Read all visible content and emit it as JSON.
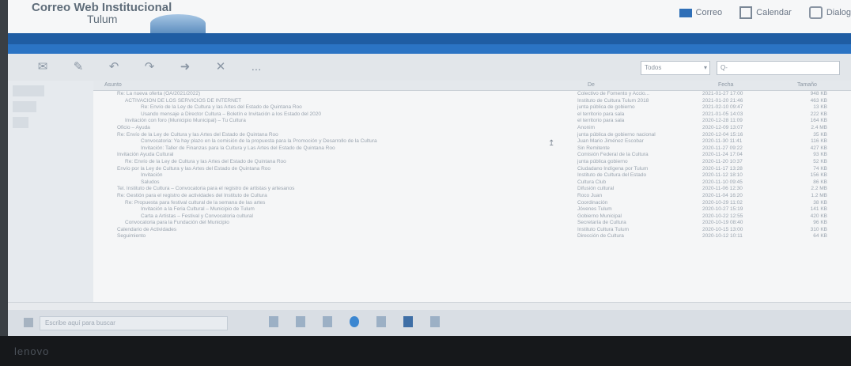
{
  "app": {
    "name_line1": "Correo Web Institucional",
    "name_line2": "Tulum"
  },
  "top_links": [
    {
      "label": "Correo",
      "icon": "mail-icon"
    },
    {
      "label": "Calendar",
      "icon": "calendar-icon"
    },
    {
      "label": "Dialog",
      "icon": "address-book-icon"
    }
  ],
  "session": "",
  "toolbar": {
    "buttons": [
      "check-mail-icon",
      "compose-icon",
      "reply-icon",
      "reply-all-icon",
      "forward-icon",
      "delete-icon",
      "more-icon"
    ],
    "more_label": "..."
  },
  "search": {
    "scope_value": "Todos",
    "placeholder": "Q-"
  },
  "columns": {
    "subject": "Asunto",
    "from": "De",
    "date": "Fecha",
    "size": "Tamaño"
  },
  "messages": [
    {
      "subject": "Re: La nueva oferta (OA/2021/2022)",
      "from": "Colectivo de Fomento y Accio...",
      "date": "2021-01-27 17:00",
      "size": "948 KB"
    },
    {
      "subject": "ACTIVACION DE LOS SERVICIOS DE INTERNET",
      "from": "Instituto de Cultura Tulum 2018",
      "date": "2021-01-20 21:46",
      "size": "463 KB"
    },
    {
      "subject": "Re: Envío de la Ley de Cultura y las Artes del Estado de Quintana Roo",
      "from": "junta pública de gobierno",
      "date": "2021-02-10 09:47",
      "size": "13 KB"
    },
    {
      "subject": "Usando mensaje a Director Cultura – Boletín e Invitación a los Estado del 2020",
      "from": "el territorio para sala",
      "date": "2021-01-05 14:03",
      "size": "222 KB"
    },
    {
      "subject": "Invitación con foro (Municipio Municipal) – Tu Cultura",
      "from": "el territorio para sala",
      "date": "2020-12-28 11:09",
      "size": "164 KB"
    },
    {
      "subject": "Oficio – Ayuda",
      "from": "Anonim",
      "date": "2020-12-09 13:07",
      "size": "2.4 MB"
    },
    {
      "subject": "Re: Envío de la Ley de Cultura y las Artes del Estado de Quintana Roo",
      "from": "junta pública de gobierno nacional",
      "date": "2020-12-04 15:16",
      "size": "35 KB"
    },
    {
      "subject": "Convocatoria: Ya hay plazo en la comisión de la propuesta para la Promoción y Desarrollo de la Cultura",
      "from": "Juan Mario Jiménez Escobar",
      "date": "2020-11-30 11:41",
      "size": "116 KB"
    },
    {
      "subject": "Invitación: Taller de Finanzas para la Cultura y Las Artes del Estado de Quintana Roo",
      "from": "Sin Remitente",
      "date": "2020-11-27 09:22",
      "size": "427 KB"
    },
    {
      "subject": "Invitación Ayuda Cultural",
      "from": "Comisión Federal de la Cultura",
      "date": "2020-11-24 17:04",
      "size": "93 KB"
    },
    {
      "subject": "Re: Envío de la Ley de Cultura y las Artes del Estado de Quintana Roo",
      "from": "junta pública gobierno",
      "date": "2020-11-20 10:37",
      "size": "52 KB"
    },
    {
      "subject": "Envío por la Ley de Cultura y las Artes del Estado de Quintana Roo",
      "from": "Ciudadano Indígena por Tulum",
      "date": "2020-11-17 13:28",
      "size": "74 KB"
    },
    {
      "subject": "Invitación",
      "from": "Instituto de Cultura del Estado",
      "date": "2020-11-12 18:10",
      "size": "156 KB"
    },
    {
      "subject": "Saludos",
      "from": "Cultura Club",
      "date": "2020-11-10 09:45",
      "size": "86 KB"
    },
    {
      "subject": "Tel. Instituto de Cultura – Convocatoria para el registro de artistas y artesanos",
      "from": "Difusión cultural",
      "date": "2020-11-06 12:30",
      "size": "2.2 MB"
    },
    {
      "subject": "Re: Gestión para el registro de actividades del Instituto de Cultura",
      "from": "Roco Juan",
      "date": "2020-11-04 16:20",
      "size": "1.2 MB"
    },
    {
      "subject": "Re: Propuesta para festival cultural de la semana de las artes",
      "from": "Coordinación",
      "date": "2020-10-29 11:02",
      "size": "38 KB"
    },
    {
      "subject": "Invitación a la Feria Cultural – Municipio de Tulum",
      "from": "Jóvenes Tulum",
      "date": "2020-10-27 15:19",
      "size": "141 KB"
    },
    {
      "subject": "Carta a Artistas – Festival y Convocatoria cultural",
      "from": "Gobierno Municipal",
      "date": "2020-10-22 12:55",
      "size": "420 KB"
    },
    {
      "subject": "Convocatoria para la Fundación del Municipio",
      "from": "Secretaría de Cultura",
      "date": "2020-10-19 08:40",
      "size": "96 KB"
    },
    {
      "subject": "Calendario de Actividades",
      "from": "Instituto Cultura Tulum",
      "date": "2020-10-15 13:00",
      "size": "310 KB"
    },
    {
      "subject": "Seguimiento",
      "from": "Dirección de Cultura",
      "date": "2020-10-12 10:11",
      "size": "64 KB"
    }
  ],
  "status": {
    "left": "",
    "center": ""
  },
  "taskbar": {
    "search_placeholder": "Escribe aquí para buscar",
    "tray": ""
  },
  "bezel": {
    "logo": "lenovo"
  }
}
